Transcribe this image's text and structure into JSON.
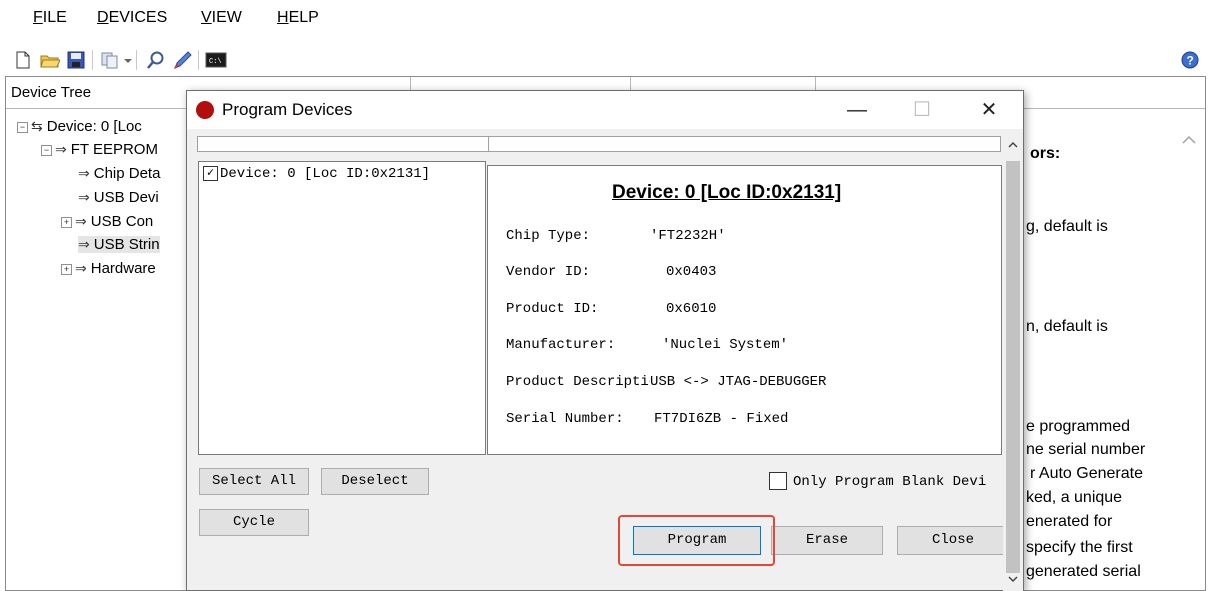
{
  "menu": [
    {
      "accel": "F",
      "rest": "ILE"
    },
    {
      "accel": "D",
      "rest": "EVICES"
    },
    {
      "accel": "V",
      "rest": "IEW"
    },
    {
      "accel": "H",
      "rest": "ELP"
    }
  ],
  "toolbar_icons": [
    "new-file-icon",
    "open-folder-icon",
    "save-icon",
    "copy-icon",
    "dropdown-icon",
    "search-icon",
    "program-icon",
    "console-icon"
  ],
  "columns": {
    "device_tree": "Device Tree"
  },
  "tree": [
    {
      "label": "Device: 0 [Loc",
      "expander": "⊟"
    },
    {
      "label": "FT EEPROM",
      "expander": "⊟"
    },
    {
      "label": "Chip Deta",
      "expander": ""
    },
    {
      "label": "USB Devi",
      "expander": ""
    },
    {
      "label": "USB Con",
      "expander": "⊞"
    },
    {
      "label": "USB Strin",
      "expander": ""
    },
    {
      "label": "Hardware",
      "expander": "⊞"
    }
  ],
  "right_panel_lines": [
    "ors:",
    "g, default is",
    "n, default is",
    "e programmed",
    "ne serial number",
    "r Auto Generate",
    "ked, a unique",
    "enerated for",
    "specify the first",
    "generated serial"
  ],
  "dialog": {
    "title": "Program Devices",
    "device_item": "Device: 0 [Loc ID:0x2131]",
    "heading": "Device: 0 [Loc ID:0x2131]",
    "fields": [
      {
        "label": "Chip Type:",
        "value": "'FT2232H'"
      },
      {
        "label": "Vendor ID:",
        "value": "0x0403"
      },
      {
        "label": "Product ID:",
        "value": "0x6010"
      },
      {
        "label": "Manufacturer:",
        "value": "'Nuclei System'"
      },
      {
        "label": "Product Descriptio",
        "value": "USB <-> JTAG-DEBUGGER"
      },
      {
        "label": "Serial Number:",
        "value": "FT7DI6ZB - Fixed"
      }
    ],
    "select_all": "Select All",
    "deselect": "Deselect",
    "cycle": "Cycle",
    "only_blank": "Only Program Blank Devi",
    "program": "Program",
    "erase": "Erase",
    "close": "Close"
  }
}
